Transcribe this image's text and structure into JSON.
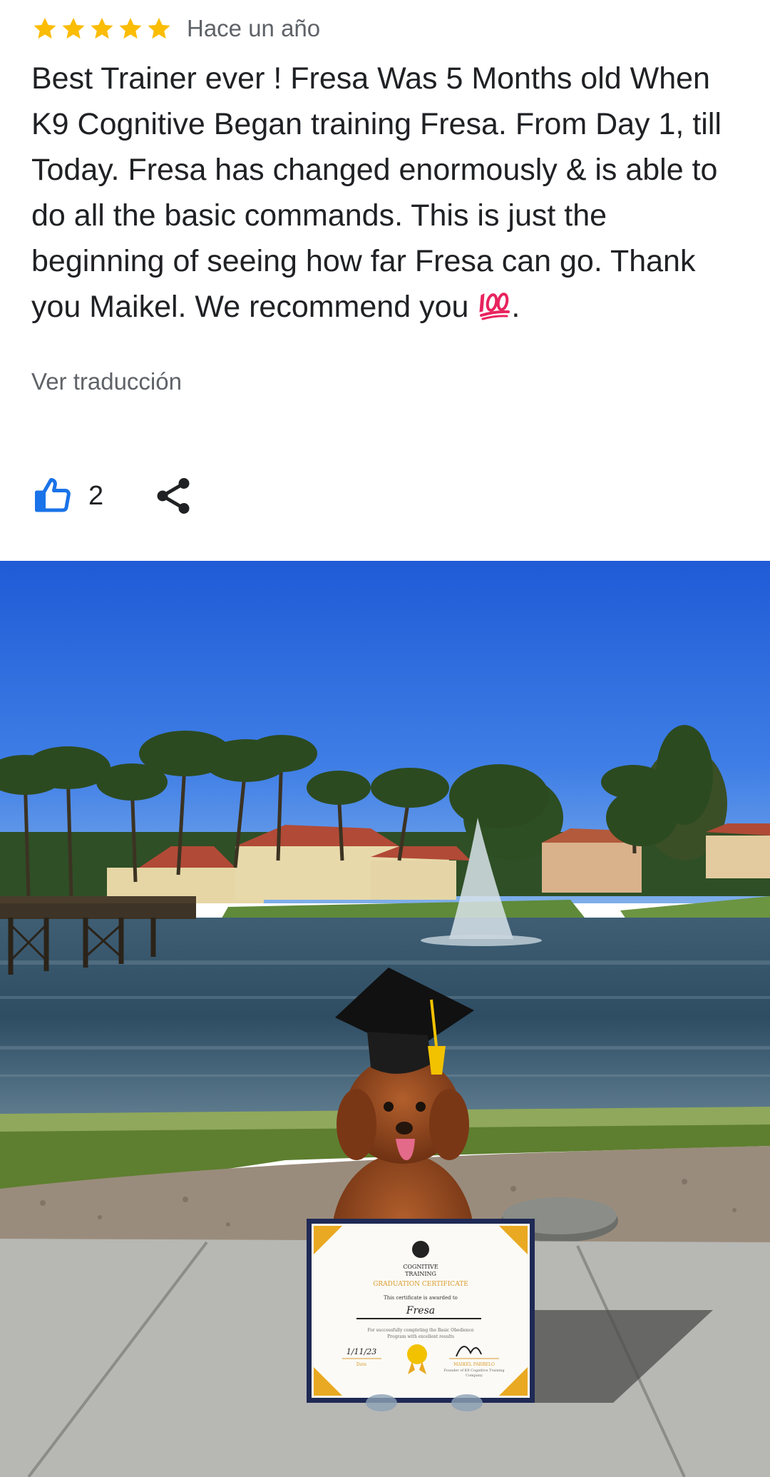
{
  "review": {
    "rating": 5,
    "star_color": "#fbbc04",
    "time": "Hace un año",
    "text": "Best Trainer ever !  Fresa Was 5 Months old When K9 Cognitive Began training Fresa. From Day 1, till Today. Fresa has changed enormously & is able to do all the basic commands. This is just the beginning of seeing how far Fresa can go. Thank you Maikel. We recommend you",
    "text_end": ".",
    "emoji": "hundred-points-emoji",
    "translate_label": "Ver traducción",
    "likes": "2",
    "like_color": "#1a73e8"
  },
  "photo": {
    "subject": "dog-graduation-photo",
    "certificate": {
      "org_line1": "COGNITIVE",
      "org_line2": "TRAINING",
      "title": "GRADUATION CERTIFICATE",
      "awarded_to": "This certificate is awarded to",
      "name": "Fresa",
      "description1": "For successfully completing the Basic Obedience",
      "description2": "Program with excellent results",
      "date": "1/11/23",
      "date_label": "Date",
      "signer": "MAIKEL PARRELO",
      "signer_title1": "Founder of K9 Cognitive Training",
      "signer_title2": "Company"
    }
  }
}
